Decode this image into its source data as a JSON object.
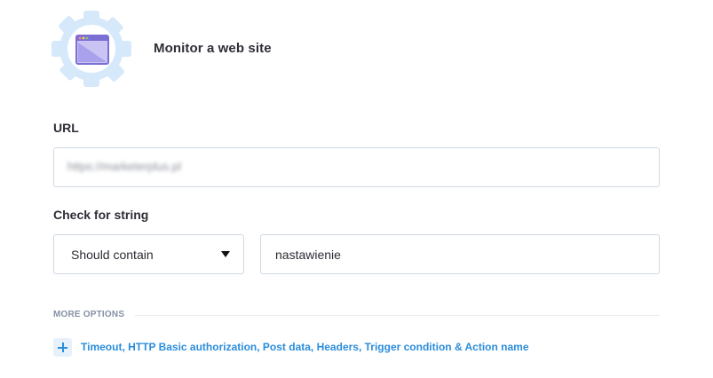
{
  "header": {
    "title": "Monitor a web site",
    "icon": "browser-window-gear-icon"
  },
  "url_section": {
    "label": "URL",
    "value": "https://marketerplus.pl"
  },
  "check_section": {
    "label": "Check for string",
    "mode_selected": "Should contain",
    "string_value": "nastawienie"
  },
  "more_options": {
    "label": "MORE OPTIONS",
    "expand_icon": "plus-icon",
    "link_text": "Timeout, HTTP Basic authorization, Post data, Headers, Trigger condition & Action name"
  },
  "colors": {
    "accent": "#2b8ddb",
    "border": "#cfd8e3",
    "badge_bg": "#d6e9fb",
    "window_purple": "#7b6fd6"
  }
}
